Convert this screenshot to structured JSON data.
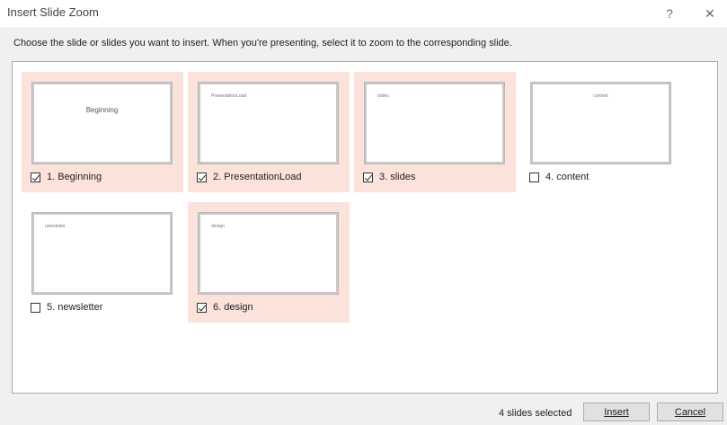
{
  "window": {
    "title": "Insert Slide Zoom",
    "help_label": "?",
    "close_label": "✕"
  },
  "instruction": "Choose the slide or slides you want to insert. When you're presenting, select it to zoom to the corresponding slide.",
  "slides": [
    {
      "label": "1. Beginning",
      "thumb_text": "Beginning",
      "checked": true
    },
    {
      "label": "2. PresentationLoad",
      "thumb_text": "PresentationLoad",
      "checked": true
    },
    {
      "label": "3. slides",
      "thumb_text": "slides",
      "checked": true
    },
    {
      "label": "4. content",
      "thumb_text": "content",
      "checked": false
    },
    {
      "label": "5. newsletter",
      "thumb_text": "newsletter",
      "checked": false
    },
    {
      "label": "6. design",
      "thumb_text": "design",
      "checked": true
    }
  ],
  "footer": {
    "status": "4 slides selected",
    "insert_label": "Insert",
    "cancel_label": "Cancel"
  },
  "colors": {
    "selected_tile": "#fbe2da",
    "dialog_bg": "#f0f0f0",
    "panel_bg": "#ffffff"
  }
}
